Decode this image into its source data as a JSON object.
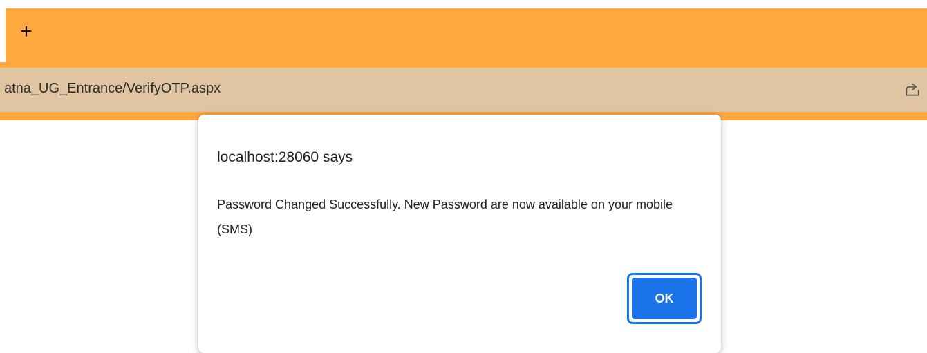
{
  "browser": {
    "new_tab_glyph": "+",
    "address_url": "atna_UG_Entrance/VerifyOTP.aspx",
    "share_icon": "share-icon"
  },
  "dialog": {
    "title": "localhost:28060 says",
    "message": "Password Changed Successfully. New Password are now available on your mobile (SMS)",
    "ok_label": "OK"
  },
  "colors": {
    "toolbar_orange": "#ffa940",
    "address_bar_beige": "#e1c5a2",
    "button_blue": "#1a73e8"
  }
}
